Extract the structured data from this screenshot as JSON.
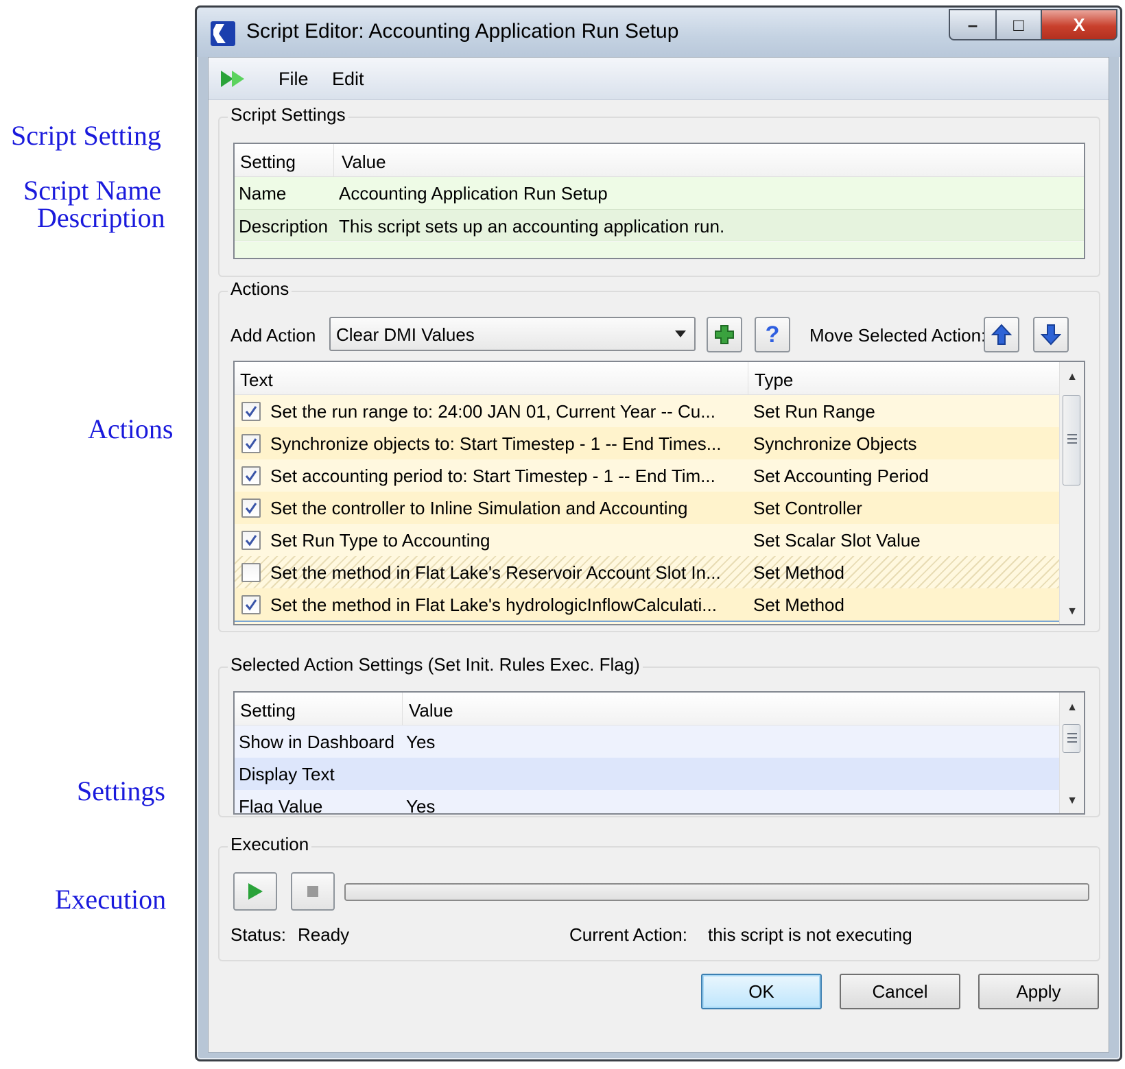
{
  "annotations": {
    "script_setting": "Script Setting",
    "script_name": "Script Name",
    "description": "Description",
    "actions": "Actions",
    "settings": "Settings",
    "execution": "Execution"
  },
  "window": {
    "title": "Script Editor: Accounting Application Run Setup",
    "minimize_label": "–",
    "maximize_label": "□",
    "close_label": "X"
  },
  "menu": {
    "file": "File",
    "edit": "Edit"
  },
  "script_settings": {
    "group_title": "Script Settings",
    "columns": [
      "Setting",
      "Value"
    ],
    "rows": [
      {
        "setting": "Name",
        "value": "Accounting Application Run Setup"
      },
      {
        "setting": "Description",
        "value": "This script sets up an accounting application run."
      }
    ]
  },
  "actions": {
    "group_title": "Actions",
    "add_action_label": "Add Action",
    "add_action_selected": "Clear DMI Values",
    "help_label": "?",
    "move_label": "Move Selected Action:",
    "columns": [
      "Text",
      "Type"
    ],
    "rows": [
      {
        "checked": true,
        "text": "Set the run range to: 24:00 JAN 01, Current Year -- Cu...",
        "type": "Set Run Range"
      },
      {
        "checked": true,
        "text": "Synchronize objects to: Start Timestep - 1 -- End Times...",
        "type": "Synchronize Objects"
      },
      {
        "checked": true,
        "text": "Set accounting period to: Start Timestep - 1 -- End Tim...",
        "type": "Set Accounting Period"
      },
      {
        "checked": true,
        "text": "Set the controller to Inline Simulation and Accounting",
        "type": "Set Controller"
      },
      {
        "checked": true,
        "text": "Set Run Type to Accounting",
        "type": "Set Scalar Slot Value"
      },
      {
        "checked": false,
        "text": "Set the method in Flat Lake's Reservoir Account Slot In...",
        "type": "Set Method"
      },
      {
        "checked": true,
        "text": "Set the method in Flat Lake's hydrologicInflowCalculati...",
        "type": "Set Method"
      }
    ]
  },
  "selected_action": {
    "group_title": "Selected Action Settings (Set Init. Rules Exec. Flag)",
    "columns": [
      "Setting",
      "Value"
    ],
    "rows": [
      {
        "setting": "Show in Dashboard",
        "value": "Yes"
      },
      {
        "setting": "Display Text",
        "value": ""
      },
      {
        "setting": "Flag Value",
        "value": "Yes"
      }
    ]
  },
  "execution": {
    "group_title": "Execution",
    "progress": 0,
    "status_label": "Status:",
    "status_value": "Ready",
    "current_action_label": "Current Action:",
    "current_action_value": "this script is not executing"
  },
  "buttons": {
    "ok": "OK",
    "cancel": "Cancel",
    "apply": "Apply"
  },
  "colors": {
    "annotation": "#1a1adc",
    "settings_row": "#eefbe6",
    "action_row": "#fff8df",
    "selected_row": "#dde6fb",
    "play_green": "#2aa33a"
  }
}
